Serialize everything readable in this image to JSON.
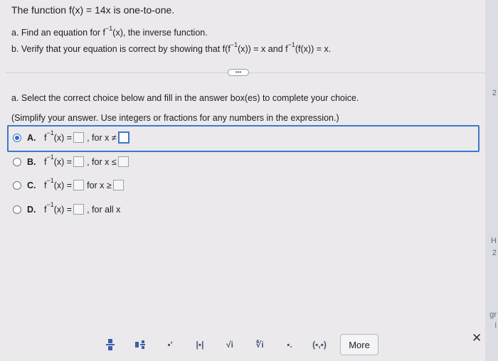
{
  "problem": {
    "title": "The function f(x) = 14x is one-to-one.",
    "part_a_pre": "a. Find an equation for f",
    "part_a_sup": "−1",
    "part_a_post": "(x), the inverse function.",
    "part_b_pre": "b. Verify that your equation is correct by showing that f",
    "part_b_mid1": "(f",
    "part_b_sup1": "−1",
    "part_b_mid2": "(x)) = x and f",
    "part_b_sup2": "−1",
    "part_b_post": "(f(x)) = x."
  },
  "expand_label": "•••",
  "instruction_line1": "a. Select the correct choice below and fill in the answer box(es) to complete your choice.",
  "instruction_line2": "(Simplify your answer. Use integers or fractions for any numbers in the expression.)",
  "choices": [
    {
      "letter": "A.",
      "fn": "f",
      "sup": "−1",
      "eq": "(x) =",
      "cond": ", for x ≠",
      "selected": true
    },
    {
      "letter": "B.",
      "fn": "f",
      "sup": "−1",
      "eq": "(x) =",
      "cond": ", for x ≤",
      "selected": false
    },
    {
      "letter": "C.",
      "fn": "f",
      "sup": "−1",
      "eq": "(x) =",
      "cond": " for x ≥",
      "selected": false
    },
    {
      "letter": "D.",
      "fn": "f",
      "sup": "−1",
      "eq": "(x) =",
      "cond": ", for all x",
      "selected": false
    }
  ],
  "toolbar": {
    "icons": [
      "fraction-icon",
      "mixed-number-icon",
      "exponent-icon",
      "absolute-value-icon",
      "square-root-icon",
      "nth-root-icon",
      "decimal-icon",
      "ordered-pair-icon"
    ],
    "sqrt_symbol": "√i",
    "nth_root_symbol": "∜i",
    "abs_symbol": "|▪|",
    "decimal_symbol": "▪.",
    "pair_symbol": "(▪,▪)",
    "exponent_symbol": "▪'",
    "more_label": "More"
  },
  "close_symbol": "✕",
  "edge_labels": [
    "2",
    "H",
    "2",
    "gr",
    "i"
  ]
}
